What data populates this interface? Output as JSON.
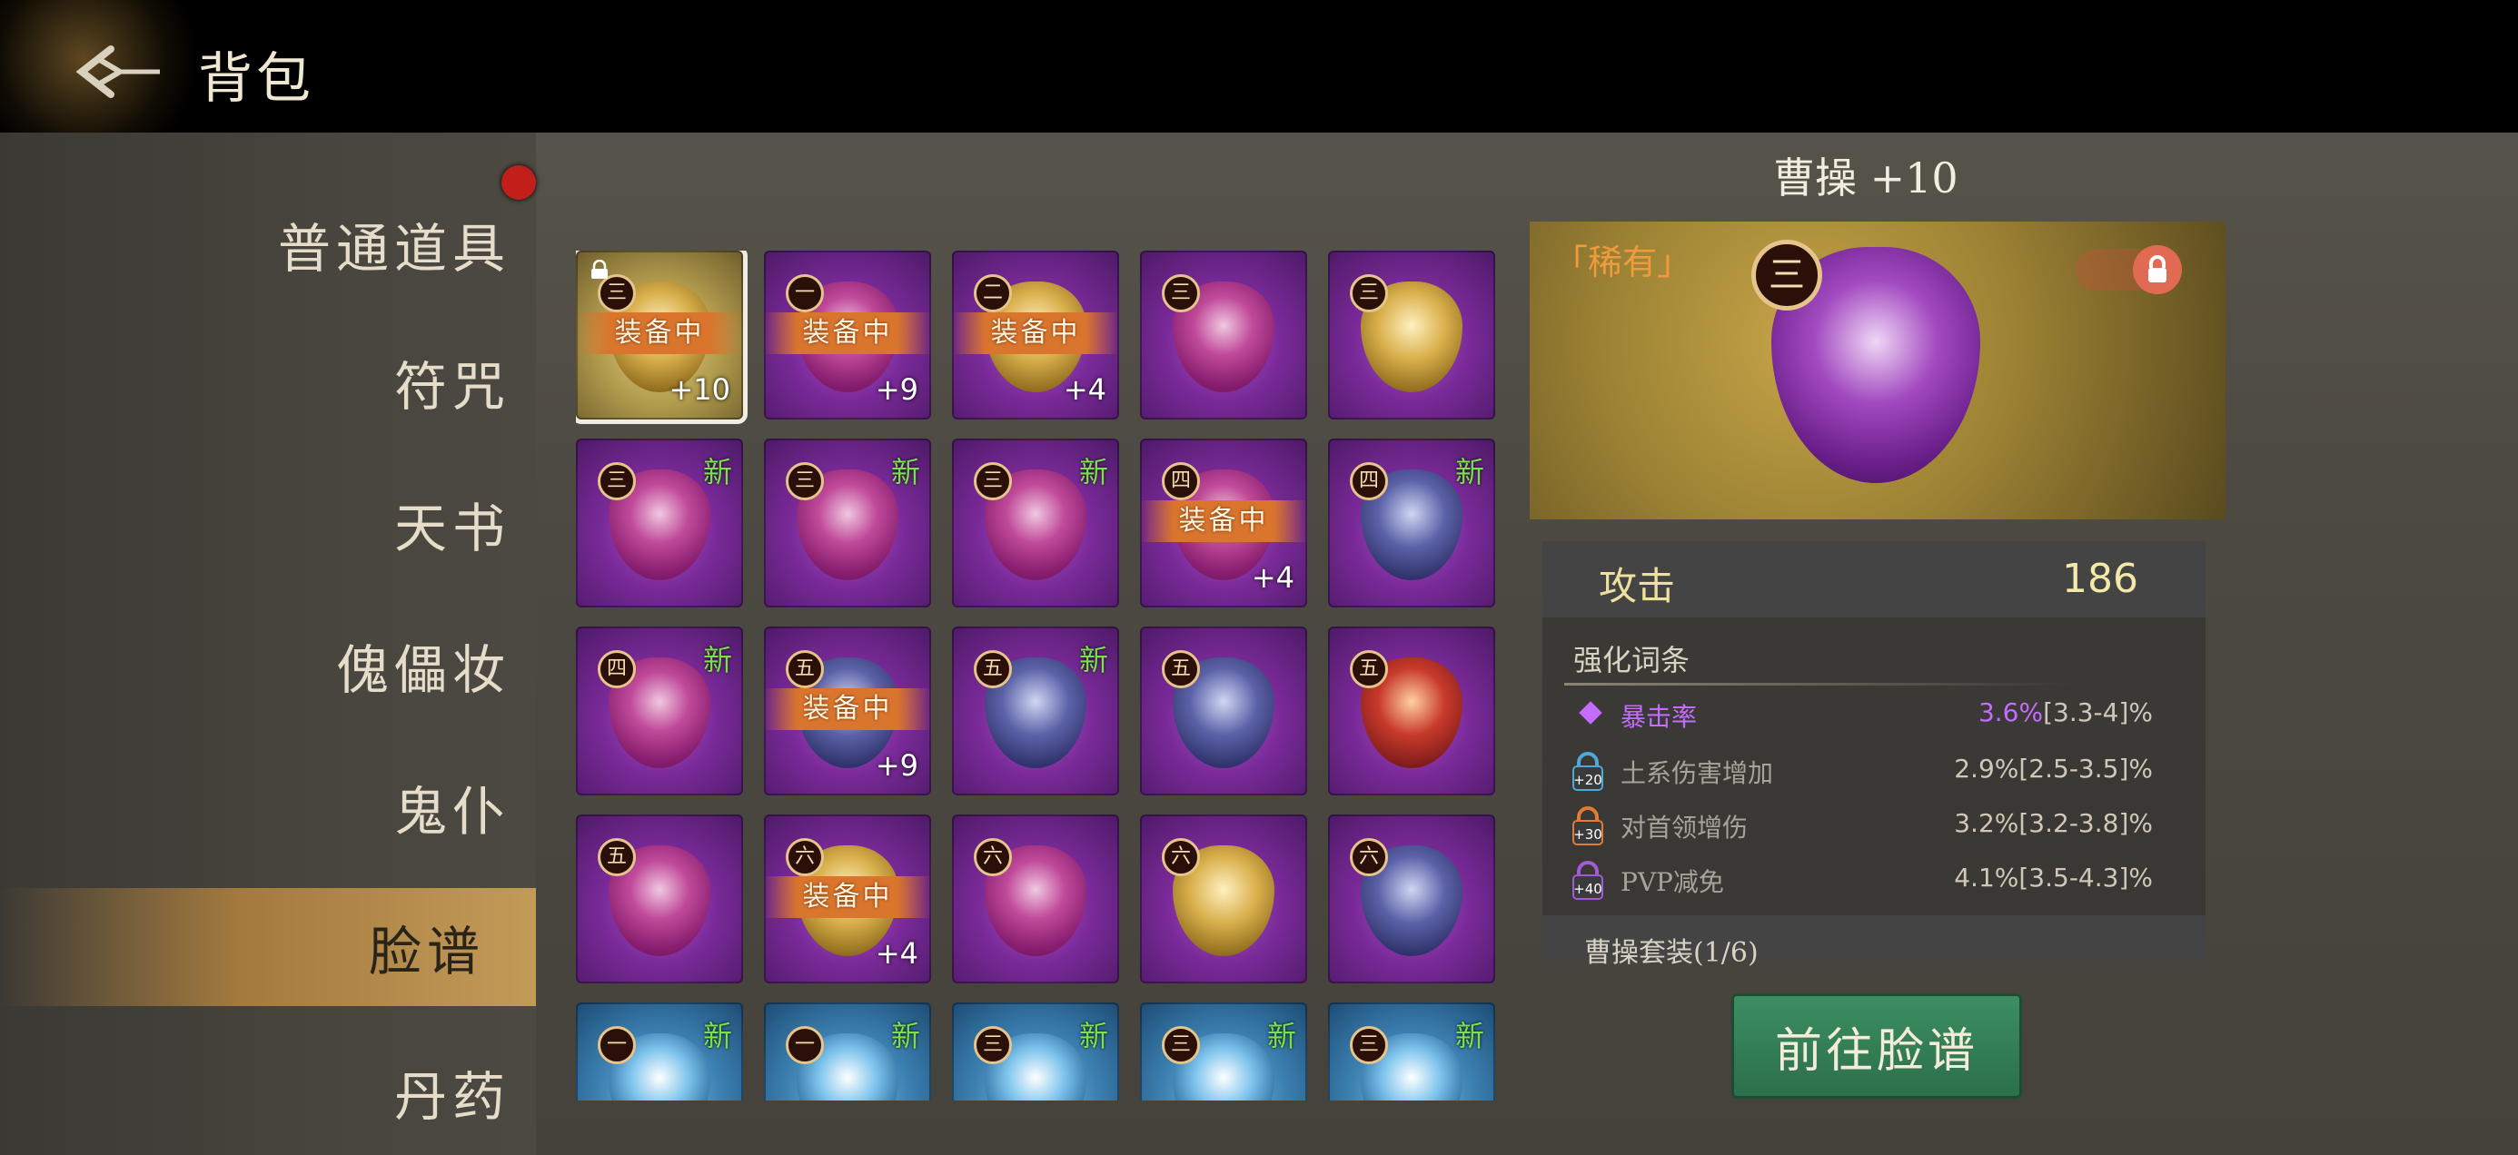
{
  "header": {
    "title": "背包"
  },
  "sidebar": {
    "items": [
      {
        "label": "普通道具",
        "badge": true
      },
      {
        "label": "符咒"
      },
      {
        "label": "天书"
      },
      {
        "label": "傀儡妆"
      },
      {
        "label": "鬼仆"
      },
      {
        "label": "脸谱",
        "active": true
      },
      {
        "label": "丹药"
      }
    ]
  },
  "grid": {
    "equipped_label": "装备中",
    "new_label": "新",
    "items": [
      {
        "tier": "三",
        "color": "gold",
        "equipped": true,
        "plus": "+10",
        "locked": true,
        "selected": true
      },
      {
        "tier": "一",
        "color": "pink",
        "equipped": true,
        "plus": "+9"
      },
      {
        "tier": "二",
        "color": "gold",
        "equipped": true,
        "plus": "+4"
      },
      {
        "tier": "三",
        "color": "pink"
      },
      {
        "tier": "三",
        "color": "gold"
      },
      {
        "tier": "三",
        "color": "pink",
        "new": true
      },
      {
        "tier": "三",
        "color": "pink",
        "new": true
      },
      {
        "tier": "三",
        "color": "pink",
        "new": true
      },
      {
        "tier": "四",
        "color": "pink",
        "equipped": true,
        "plus": "+4"
      },
      {
        "tier": "四",
        "color": "navy",
        "new": true
      },
      {
        "tier": "四",
        "color": "pink",
        "new": true
      },
      {
        "tier": "五",
        "color": "navy",
        "equipped": true,
        "plus": "+9"
      },
      {
        "tier": "五",
        "color": "navy",
        "new": true
      },
      {
        "tier": "五",
        "color": "navy"
      },
      {
        "tier": "五",
        "color": "red"
      },
      {
        "tier": "五",
        "color": "pink"
      },
      {
        "tier": "六",
        "color": "gold",
        "equipped": true,
        "plus": "+4"
      },
      {
        "tier": "六",
        "color": "pink"
      },
      {
        "tier": "六",
        "color": "gold"
      },
      {
        "tier": "六",
        "color": "navy"
      },
      {
        "tier": "一",
        "color": "bluem",
        "new": true,
        "bg": "blue"
      },
      {
        "tier": "一",
        "color": "bluem",
        "new": true,
        "bg": "blue"
      },
      {
        "tier": "三",
        "color": "bluem",
        "new": true,
        "bg": "blue"
      },
      {
        "tier": "三",
        "color": "bluem",
        "new": true,
        "bg": "blue"
      },
      {
        "tier": "三",
        "color": "bluem",
        "new": true,
        "bg": "blue"
      }
    ]
  },
  "detail": {
    "name": "曹操 +10",
    "rarity": "「稀有」",
    "tier": "三",
    "attack_label": "攻击",
    "attack_value": "186",
    "affix_title": "强化词条",
    "affixes": [
      {
        "name": "暴击率",
        "cur": "3.6%",
        "range": "[3.3-4]%",
        "highlight": true
      },
      {
        "name": "土系伤害增加",
        "cur": "2.9%",
        "range": "[2.5-3.5]%",
        "unlock": "+20",
        "lock_color": "#4fa8d8"
      },
      {
        "name": "对首领增伤",
        "cur": "3.2%",
        "range": "[3.2-3.8]%",
        "unlock": "+30",
        "lock_color": "#e07a34"
      },
      {
        "name": "PVP减免",
        "cur": "4.1%",
        "range": "[3.5-4.3]%",
        "unlock": "+40",
        "lock_color": "#a35ad6"
      }
    ],
    "set_text": "曹操套装(1/6)",
    "goto_button": "前往脸谱"
  }
}
